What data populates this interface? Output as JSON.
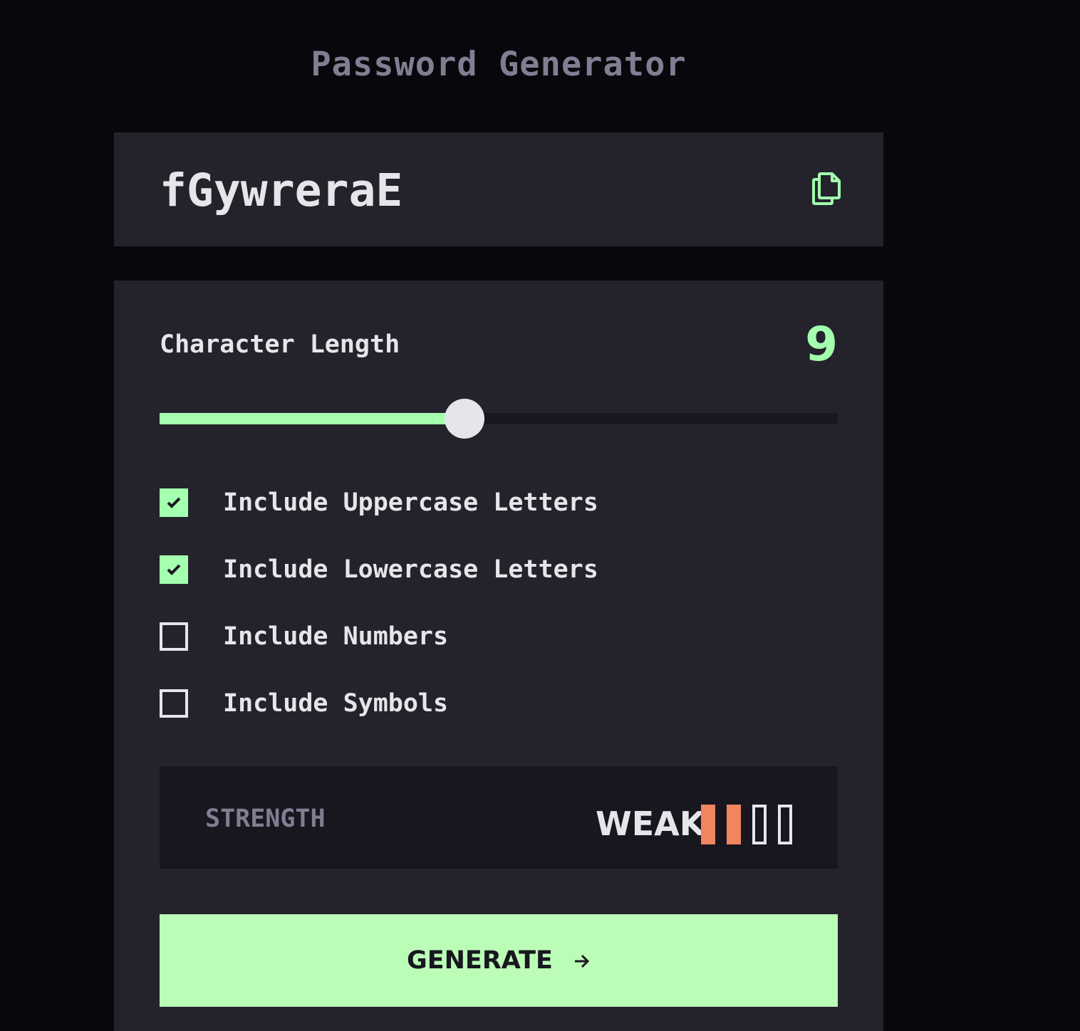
{
  "app": {
    "title": "Password Generator"
  },
  "password": {
    "value": "fGywreraE",
    "copy_icon": "copy-icon"
  },
  "length": {
    "label": "Character Length",
    "value": "9",
    "min": 0,
    "max": 20,
    "current": 9
  },
  "options": [
    {
      "label": "Include Uppercase Letters",
      "checked": true
    },
    {
      "label": "Include Lowercase Letters",
      "checked": true
    },
    {
      "label": "Include Numbers",
      "checked": false
    },
    {
      "label": "Include Symbols",
      "checked": false
    }
  ],
  "strength": {
    "label": "STRENGTH",
    "rating": "WEAK",
    "level": 2,
    "total": 4,
    "color": "#f0855e"
  },
  "generate": {
    "label": "GENERATE",
    "icon": "arrow-right-icon"
  },
  "colors": {
    "accent": "#a4ffaf",
    "background": "#08070b",
    "panel": "#24232c"
  }
}
